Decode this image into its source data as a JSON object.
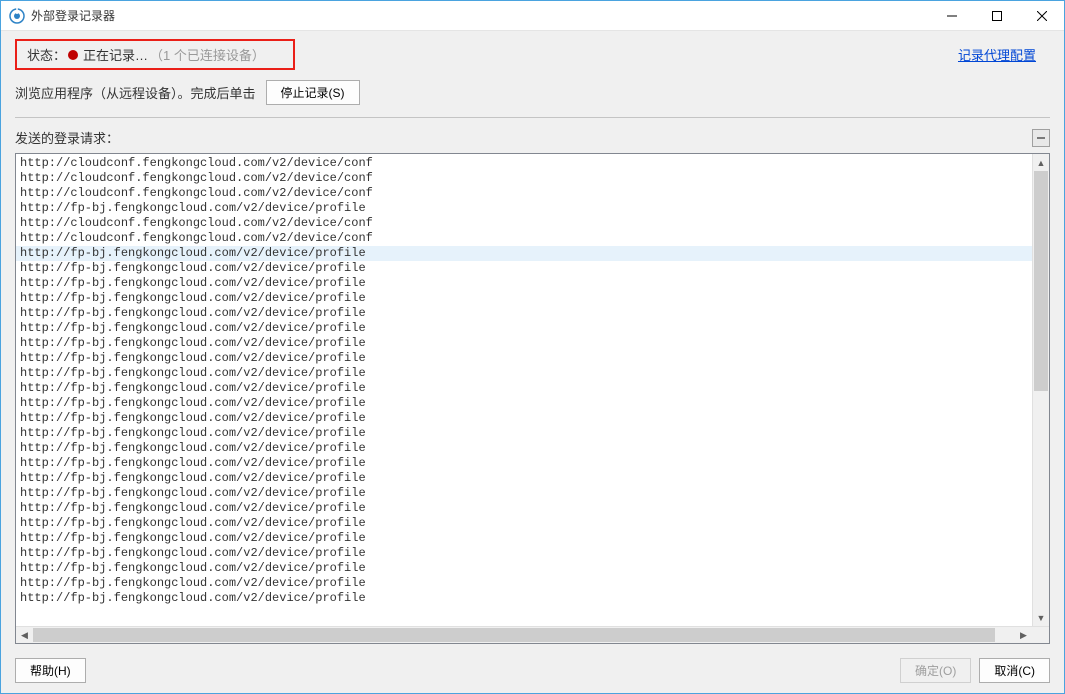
{
  "window": {
    "title": "外部登录记录器"
  },
  "status": {
    "label": "状态：",
    "recording_text": "正在记录…",
    "devices_text": "（1 个已连接设备）"
  },
  "proxy_link_label": "记录代理配置",
  "instruction": "浏览应用程序（从远程设备）。完成后单击",
  "stop_button_label": "停止记录(S)",
  "section": {
    "title": "发送的登录请求："
  },
  "requests": [
    "http://cloudconf.fengkongcloud.com/v2/device/conf",
    "http://cloudconf.fengkongcloud.com/v2/device/conf",
    "http://cloudconf.fengkongcloud.com/v2/device/conf",
    "http://fp-bj.fengkongcloud.com/v2/device/profile",
    "http://cloudconf.fengkongcloud.com/v2/device/conf",
    "http://cloudconf.fengkongcloud.com/v2/device/conf",
    "http://fp-bj.fengkongcloud.com/v2/device/profile",
    "http://fp-bj.fengkongcloud.com/v2/device/profile",
    "http://fp-bj.fengkongcloud.com/v2/device/profile",
    "http://fp-bj.fengkongcloud.com/v2/device/profile",
    "http://fp-bj.fengkongcloud.com/v2/device/profile",
    "http://fp-bj.fengkongcloud.com/v2/device/profile",
    "http://fp-bj.fengkongcloud.com/v2/device/profile",
    "http://fp-bj.fengkongcloud.com/v2/device/profile",
    "http://fp-bj.fengkongcloud.com/v2/device/profile",
    "http://fp-bj.fengkongcloud.com/v2/device/profile",
    "http://fp-bj.fengkongcloud.com/v2/device/profile",
    "http://fp-bj.fengkongcloud.com/v2/device/profile",
    "http://fp-bj.fengkongcloud.com/v2/device/profile",
    "http://fp-bj.fengkongcloud.com/v2/device/profile",
    "http://fp-bj.fengkongcloud.com/v2/device/profile",
    "http://fp-bj.fengkongcloud.com/v2/device/profile",
    "http://fp-bj.fengkongcloud.com/v2/device/profile",
    "http://fp-bj.fengkongcloud.com/v2/device/profile",
    "http://fp-bj.fengkongcloud.com/v2/device/profile",
    "http://fp-bj.fengkongcloud.com/v2/device/profile",
    "http://fp-bj.fengkongcloud.com/v2/device/profile",
    "http://fp-bj.fengkongcloud.com/v2/device/profile",
    "http://fp-bj.fengkongcloud.com/v2/device/profile",
    "http://fp-bj.fengkongcloud.com/v2/device/profile"
  ],
  "selected_index": 6,
  "footer": {
    "help_label": "帮助(H)",
    "ok_label": "确定(O)",
    "cancel_label": "取消(C)"
  }
}
